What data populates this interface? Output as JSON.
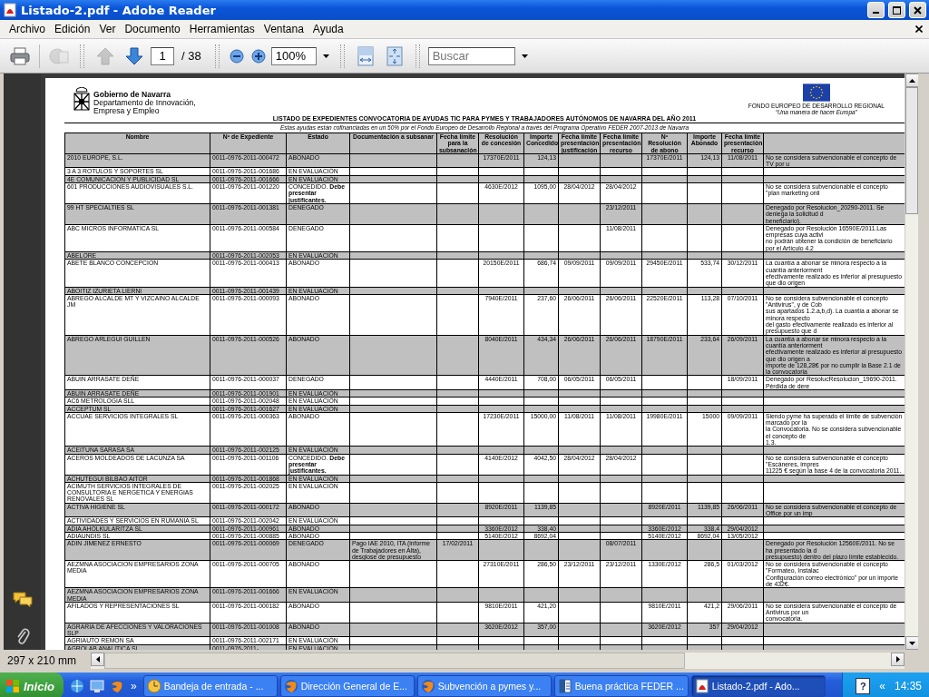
{
  "window": {
    "title": "Listado-2.pdf - Adobe Reader"
  },
  "menu": [
    "Archivo",
    "Edición",
    "Ver",
    "Documento",
    "Herramientas",
    "Ventana",
    "Ayuda"
  ],
  "toolbar": [
    {
      "kind": "print",
      "disabled": false
    },
    {
      "kind": "share",
      "disabled": true
    },
    {
      "kind": "previous_page",
      "disabled": true
    },
    {
      "kind": "next_page",
      "disabled": false
    },
    {
      "kind": "page_field",
      "value": "1",
      "total": "/ 38"
    },
    {
      "kind": "zoom_out"
    },
    {
      "kind": "zoom_in"
    },
    {
      "kind": "zoom_field",
      "value": "100%"
    },
    {
      "kind": "fit_width"
    },
    {
      "kind": "fit_page"
    },
    {
      "kind": "search",
      "placeholder": "Buscar"
    }
  ],
  "document": {
    "org_name": "Gobierno de Navarra",
    "department": "Departamento de Innovación,\nEmpresa y Empleo",
    "fund_name": "FONDO EUROPEO DE DESARROLLO REGIONAL",
    "fund_motto": "“Una manera de hacer Europa”",
    "title": "LISTADO DE EXPEDIENTES CONVOCATORIA DE AYUDAS TIC PARA PYMES Y TRABAJADORES AUTÓNOMOS DE NAVARRA DEL AÑO 2011",
    "subtitle": "Estas ayudas están cofinanciadas en un 50% por el Fondo Europeo de Desarrollo Regional a través del Programa Operativo FEDER 2007-2013 de Navarra",
    "table": {
      "columns": [
        "Nombre",
        "Nº de Expediente",
        "Estado",
        "Documentación a subsanar",
        "Fecha límite para la subsanación",
        "Resolución de concesión",
        "Importe Concedido",
        "Fecha límite presentación justificación",
        "Fecha límite presentación recurso",
        "Nº Resolución de abono",
        "Importe Abonado",
        "Fecha límite presentación recurso"
      ],
      "rows": [
        {
          "cells": [
            "2010 EUROPE, S.L.",
            "0011-0976-2011-000472",
            "ABONADO",
            null,
            null,
            "17370E/2011",
            "124,13",
            null,
            null,
            "17370E/2011",
            "124,13",
            "11/08/2011",
            "No se considera subvencionable el concepto de TV por u"
          ]
        },
        {
          "cells": [
            "3 A 3 ROTULOS Y SOPORTES SL",
            "0011-0976-2011-001686",
            "EN EVALUACIÓN",
            null,
            null,
            null,
            null,
            null,
            null,
            null,
            null,
            null,
            null
          ]
        },
        {
          "cells": [
            "4E COMUNICACION Y PUBLICIDAD SL",
            "0011-0976-2011-001666",
            "EN EVALUACIÓN",
            null,
            null,
            null,
            null,
            null,
            null,
            null,
            null,
            null,
            null
          ]
        },
        {
          "cells": [
            "601 PRODUCCIONES AUDIOVISUALES S.L.",
            "0011-0976-2011-001220",
            "CONCEDIDO. **Debe presentar justificantes.**",
            null,
            null,
            "4630E/2012",
            "1095,00",
            "28/04/2012",
            "28/04/2012",
            null,
            null,
            null,
            "No se considera subvencionable el concepto \"plan marketing onli"
          ]
        },
        {
          "cells": [
            "99 HT SPECIALTIES SL",
            "0011-0976-2011-001381",
            "DENEGADO",
            null,
            null,
            null,
            null,
            null,
            "23/12/2011",
            null,
            null,
            null,
            "Denegado por Resolucion_20290-2011. Se deniega la solicitud d\nbeneficiario)."
          ]
        },
        {
          "cells": [
            "ABC MICROS INFORMATICA SL",
            "0011-0976-2011-000584",
            "DENEGADO",
            null,
            null,
            null,
            null,
            null,
            "11/08/2011",
            null,
            null,
            null,
            "Denegado por Resolución 16590E/2011.Las empresas cuya activi\nno podrán obtener la condición de beneficiario por el Artículo 4.2"
          ]
        },
        {
          "cells": [
            "ABELORE",
            "0011-0976-2011-002053",
            "EN EVALUACIÓN",
            null,
            null,
            null,
            null,
            null,
            null,
            null,
            null,
            null,
            null
          ]
        },
        {
          "cells": [
            "ABETE BLANCO CONCEPCION",
            "0011-0976-2011-000413",
            "ABONADO",
            null,
            null,
            "20150E/2011",
            "686,74",
            "09/09/2011",
            "09/09/2011",
            "29450E/2011",
            "533,74",
            "30/12/2011",
            "La cuantía a abonar se minora respecto a la cuantía anteriorment\nefectivamente realizado es inferior al presupuesto que dio origen"
          ]
        },
        {
          "cells": [
            "ABOITIZ IZURIETA LIERNI",
            "0011-0976-2011-001439",
            "EN EVALUACIÓN",
            null,
            null,
            null,
            null,
            null,
            null,
            null,
            null,
            null,
            null
          ]
        },
        {
          "cells": [
            "ABREGO ALCALDE MT Y VIZCAINO ALCALDE JM",
            "0011-0976-2011-000093",
            "ABONADO",
            null,
            null,
            "7940E/2011",
            "237,60",
            "26/06/2011",
            "26/06/2011",
            "22520E/2011",
            "113,28",
            "07/10/2011",
            "No se considera subvencionable el concepto \"Antivirus\", y de Cob\nsus apartados 1.2.a,b,d). La cuantía a abonar se minora respecto\ndel gasto efectivamente realizado es inferior al presupuesto que d"
          ]
        },
        {
          "cells": [
            "ABREGO ARLEGUI GUILLEN",
            "0011-0976-2011-000526",
            "ABONADO",
            null,
            null,
            "8040E/2011",
            "434,34",
            "26/06/2011",
            "26/06/2011",
            "18790E/2011",
            "233,64",
            "26/09/2011",
            "La cuantía a abonar se minora respecto a la cuantía anteriorment\nefectivamente realizado es inferior al presupuesto que dio origen a\nimporte de 128,28€ por no cumplir la Base 2.1 de la convocatoria"
          ]
        },
        {
          "cells": [
            "ABUIN ARRASATE DEÑE",
            "0011-0976-2011-000037",
            "DENEGADO",
            null,
            null,
            "4440E/2011",
            "708,00",
            "06/05/2011",
            "06/05/2011",
            null,
            null,
            "18/09/2011",
            "Denegado por ResolucResolucion_19690-2011. Pérdida de dere"
          ]
        },
        {
          "cells": [
            "ABUIN ARRASATE DEÑE",
            "0011-0976-2011-001901",
            "EN EVALUACIÓN",
            null,
            null,
            null,
            null,
            null,
            null,
            null,
            null,
            null,
            null
          ]
        },
        {
          "cells": [
            "AC6 METROLOGIA SLL",
            "0011-0976-2011-002048",
            "EN EVALUACIÓN",
            null,
            null,
            null,
            null,
            null,
            null,
            null,
            null,
            null,
            null
          ]
        },
        {
          "cells": [
            "ACCEPTUM SL",
            "0011-0976-2011-001627",
            "EN EVALUACIÓN",
            null,
            null,
            null,
            null,
            null,
            null,
            null,
            null,
            null,
            null
          ]
        },
        {
          "cells": [
            "ACCUAE SERVICIOS INTEGRALES SL",
            "0011-0976-2011-000363",
            "ABONADO",
            null,
            null,
            "17230E/2011",
            "15000,00",
            "11/08/2011",
            "11/08/2011",
            "19980E/2011",
            "15000",
            "09/09/2011",
            "Siendo pyme ha superado el límite de subvención marcado por la\nla Convocatoria. No se considera subvencionable el concepto de\n1.3."
          ]
        },
        {
          "cells": [
            "ACEITUNA SARASA SA",
            "0011-0976-2011-002125",
            "EN EVALUACIÓN",
            null,
            null,
            null,
            null,
            null,
            null,
            null,
            null,
            null,
            null
          ]
        },
        {
          "cells": [
            "ACEROS MOLDEADOS DE LACUNZA SA",
            "0011-0976-2011-001106",
            "CONCEDIDO. **Debe presentar justificantes.**",
            null,
            null,
            "4140E/2012",
            "4042,50",
            "28/04/2012",
            "28/04/2012",
            null,
            null,
            null,
            "No se considera subvencionable el concepto \"Escáneres, impres\n11225 € según la base 4 de la convocatoria 2011."
          ]
        },
        {
          "cells": [
            "ACHUTEGUI BILBAO AITOR",
            "0011-0976-2011-001868",
            "EN EVALUACIÓN",
            null,
            null,
            null,
            null,
            null,
            null,
            null,
            null,
            null,
            null
          ]
        },
        {
          "cells": [
            "ACIMUTH SERVICIOS INTEGRALES DE CONSULTORIA E NERGETICA Y ENERGIAS RENOVALES SL",
            "0011-0976-2011-002025",
            "EN EVALUACIÓN",
            null,
            null,
            null,
            null,
            null,
            null,
            null,
            null,
            null,
            null
          ]
        },
        {
          "cells": [
            "ACTIVA HIGIENE SL",
            "0011-0976-2011-000172",
            "ABONADO",
            null,
            null,
            "8920E/2011",
            "1139,85",
            null,
            null,
            "8920E/2011",
            "1139,85",
            "26/06/2011",
            "No se considera subvencionable el concepto de Office por un imp"
          ]
        },
        {
          "cells": [
            "ACTIVIDADES Y SERVICIOS EN RUMANIA SL",
            "0011-0976-2011-002042",
            "EN EVALUACIÓN",
            null,
            null,
            null,
            null,
            null,
            null,
            null,
            null,
            null,
            null
          ]
        },
        {
          "cells": [
            "ADIA AHOLKULARITZA SL",
            "0011-0976-2011-000961",
            "ABONADO",
            null,
            null,
            "3360E/2012",
            "338,40",
            null,
            null,
            "3360E/2012",
            "338,4",
            "29/04/2012",
            null
          ]
        },
        {
          "cells": [
            "ADIAUNDIS SL",
            "0011-0976-2011-000885",
            "ABONADO",
            null,
            null,
            "5140E/2012",
            "8692,04",
            null,
            null,
            "5140E/2012",
            "8692,04",
            "13/05/2012",
            null
          ]
        },
        {
          "cells": [
            "ADIN JIMENEZ ERNESTO",
            "0011-0976-2011-000069",
            "DENEGADO",
            "Pago IAE 2010, ITA (informe de Trabajadores en Alta), desglose de presupuesto",
            "17/02/2011",
            null,
            null,
            null,
            "08/07/2011",
            null,
            null,
            null,
            "Denegado por Resolución 12560E/2011. No se ha presentado la d\npresupuesto) dentro del plazo límite establecido."
          ]
        },
        {
          "cells": [
            "AEZMNA ASOCIACION EMPRESARIOS ZONA MEDIA",
            "0011-0976-2011-000705",
            "ABONADO",
            null,
            null,
            "27310E/2011",
            "286,50",
            "23/12/2011",
            "23/12/2011",
            "1330E/2012",
            "286,5",
            "01/03/2012",
            "No se considera subvencionable el concepto \"Formateo, Instalac\nConfiguración correo electrónico\" por un importe de 432€."
          ]
        },
        {
          "cells": [
            "AEZMNA ASOCIACION EMPRESARIOS ZONA MEDIA",
            "0011-0976-2011-001666",
            "EN EVALUACIÓN",
            null,
            null,
            null,
            null,
            null,
            null,
            null,
            null,
            null,
            null
          ]
        },
        {
          "cells": [
            "AFILADOS Y REPRESENTACIONES SL",
            "0011-0976-2011-000182",
            "ABONADO",
            null,
            null,
            "9810E/2011",
            "421,20",
            null,
            null,
            "9810E/2011",
            "421,2",
            "29/06/2011",
            "No se considera subvencionable el concepto de Antivirus por un\nconvocatoria."
          ]
        },
        {
          "cells": [
            "AGRARIA DE AFECCIONES Y VALORACIONES SLP",
            "0011-0976-2011-001008",
            "ABONADO",
            null,
            null,
            "3620E/2012",
            "357,00",
            null,
            null,
            "3620E/2012",
            "357",
            "29/04/2012",
            null
          ]
        },
        {
          "cells": [
            "AGRIAUTO REMON SA",
            "0011-0976-2011-002171",
            "EN EVALUACIÓN",
            null,
            null,
            null,
            null,
            null,
            null,
            null,
            null,
            null,
            null
          ]
        },
        {
          "cells": [
            "AGROLAB ANALITICA SL",
            "0011-0976-2011-",
            "EN EVALUACIÓN",
            null,
            null,
            null,
            null,
            null,
            null,
            null,
            null,
            null,
            null
          ]
        }
      ]
    }
  },
  "status_bar": {
    "page_size": "297 x 210 mm"
  },
  "taskbar": {
    "start": "Inicio",
    "more": "»",
    "tasks": [
      {
        "kind": "clock",
        "label": "Bandeja de entrada - ...",
        "selected": false
      },
      {
        "kind": "browser",
        "label": "Dirección General de E...",
        "selected": false
      },
      {
        "kind": "browser",
        "label": "Subvención a pymes y...",
        "selected": false
      },
      {
        "kind": "document",
        "label": "Buena práctica FEDER ...",
        "selected": false
      },
      {
        "kind": "pdf",
        "label": "Listado-2.pdf - Ado...",
        "selected": true
      }
    ],
    "help": "?",
    "expand": "«",
    "clock": "14:35"
  }
}
